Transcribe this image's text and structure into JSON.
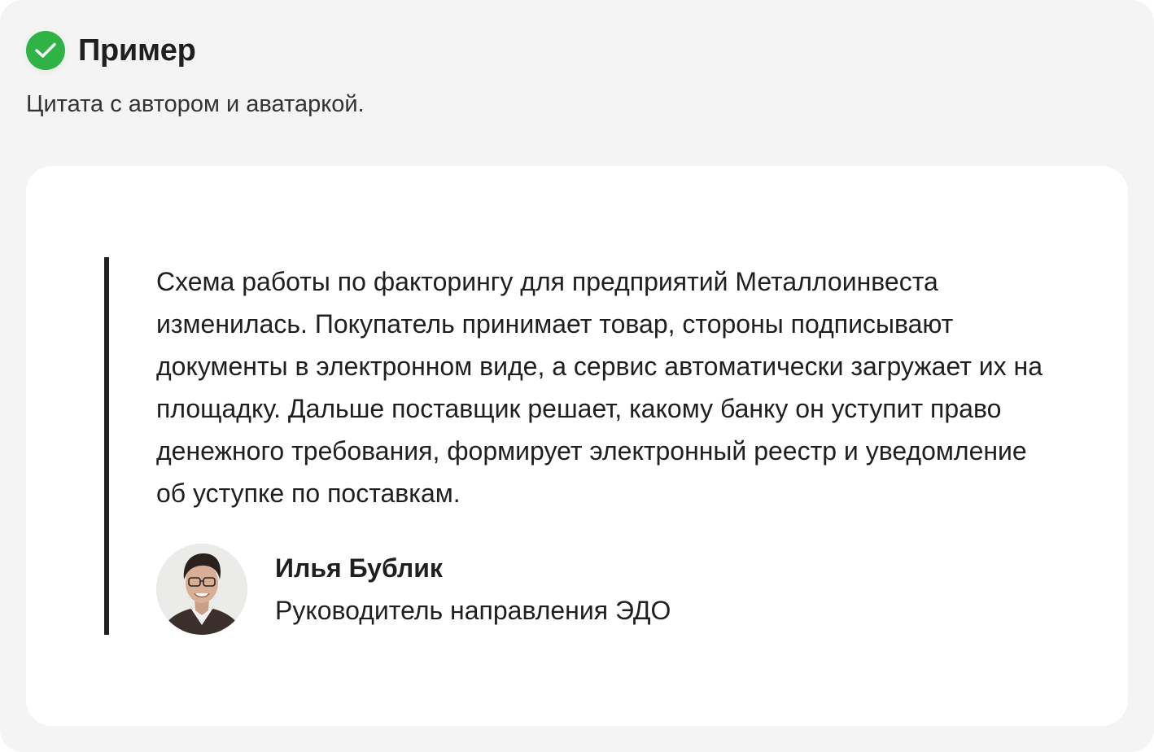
{
  "header": {
    "title": "Пример",
    "icon": "check-circle-icon",
    "icon_color": "#2fb344"
  },
  "subtitle": "Цитата с автором и аватаркой.",
  "quote": {
    "text": "Схема работы по факторингу для предприятий Металлоинвеста изменилась. Покупатель принимает товар, стороны подписывают документы в электронном виде, а сервис автоматически загружает их на площадку. Дальше поставщик решает, какому банку он уступит право денежного требования, формирует электронный реестр и уведомление об уступке по поставкам.",
    "border_color": "#222222"
  },
  "author": {
    "name": "Илья Бублик",
    "role": "Руководитель направления ЭДО",
    "avatar_icon": "person-avatar"
  }
}
